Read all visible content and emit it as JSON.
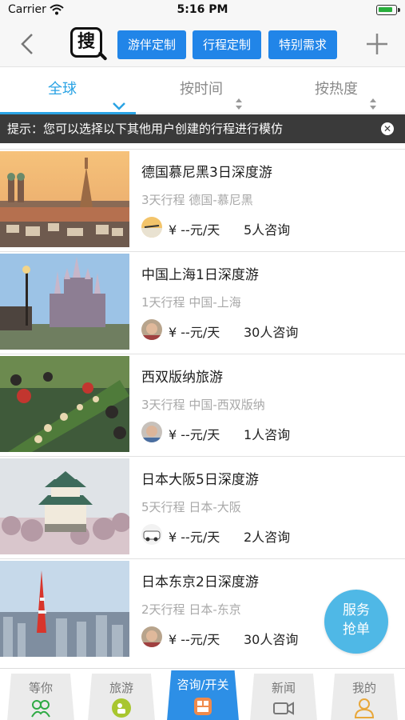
{
  "status_bar": {
    "carrier": "Carrier",
    "time": "5:16 PM"
  },
  "nav": {
    "logo_char": "搜",
    "buttons": [
      "游伴定制",
      "行程定制",
      "特别需求"
    ]
  },
  "filters": [
    {
      "label": "全球",
      "active": true
    },
    {
      "label": "按时间",
      "active": false
    },
    {
      "label": "按热度",
      "active": false
    }
  ],
  "tip": {
    "text": "提示：您可以选择以下其他用户创建的行程进行模仿"
  },
  "trips": [
    {
      "title": "德国慕尼黑3日深度游",
      "days": "3天行程",
      "place": "德国-慕尼黑",
      "price": "¥ --元/天",
      "consult": "5人咨询",
      "image": "munich-cityscape"
    },
    {
      "title": "中国上海1日深度游",
      "days": "1天行程",
      "place": "中国-上海",
      "price": "¥ --元/天",
      "consult": "30人咨询",
      "image": "disney-castle"
    },
    {
      "title": "西双版纳旅游",
      "days": "3天行程",
      "place": "中国-西双版纳",
      "price": "¥ --元/天",
      "consult": "1人咨询",
      "image": "long-table-feast"
    },
    {
      "title": "日本大阪5日深度游",
      "days": "5天行程",
      "place": "日本-大阪",
      "price": "¥ --元/天",
      "consult": "2人咨询",
      "image": "osaka-castle"
    },
    {
      "title": "日本东京2日深度游",
      "days": "2天行程",
      "place": "日本-东京",
      "price": "¥ --元/天",
      "consult": "30人咨询",
      "image": "tokyo-tower"
    }
  ],
  "fab": {
    "line1": "服务",
    "line2": "抢单"
  },
  "tabs": [
    {
      "label": "等你",
      "icon": "group-icon",
      "active": false
    },
    {
      "label": "旅游",
      "icon": "travel-icon",
      "active": false
    },
    {
      "label": "咨询/开关",
      "icon": "consult-icon",
      "active": true
    },
    {
      "label": "新闻",
      "icon": "video-camera-icon",
      "active": false
    },
    {
      "label": "我的",
      "icon": "person-icon",
      "active": false
    }
  ],
  "colors": {
    "accent": "#2185e8",
    "filter_active": "#2aa3e4",
    "fab": "#4fb8e6",
    "tip_bg": "#3a3a3a"
  }
}
